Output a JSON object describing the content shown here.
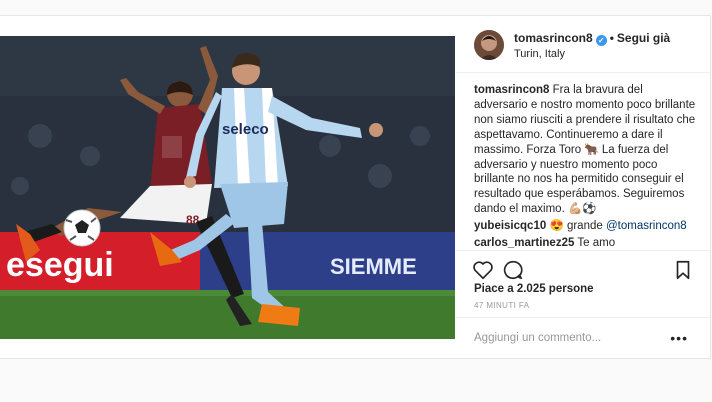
{
  "post": {
    "username": "tomasrincon8",
    "verified_mark": "✓",
    "separator": "•",
    "follow_label": "Segui già",
    "location": "Turin, Italy",
    "caption": "Fra la bravura del adversario e nostro momento poco brillante non siamo riusciti a prendere il risultato che aspettavamo. Continueremo a dare il massimo. Forza Toro 🐂 La fuerza del adversario y nuestro momento poco brillante no nos ha permitido conseguir el resultado que esperábamos. Seguiremos dando el maximo. 💪🏼⚽",
    "comments": [
      {
        "user": "yubeisicqc10",
        "text": "😍 grande ",
        "mention": "@tomasrincon8"
      },
      {
        "user": "carlos_martinez25",
        "text": "Te amo",
        "mention": ""
      }
    ],
    "likes": "Piace a 2.025 persone",
    "time": "47 MINUTI FA",
    "comment_placeholder": "Aggiungi un commento...",
    "more": "•••"
  },
  "photo": {
    "banner_left": "esegui",
    "banner_right": "SIEMME",
    "jersey_sponsor": "seleco",
    "jersey_number": "88"
  },
  "icons": [
    "heart-icon",
    "comment-icon",
    "bookmark-icon",
    "verified-icon",
    "more-icon"
  ],
  "colors": {
    "accent": "#3897f0",
    "text": "#262626",
    "muted": "#999999"
  }
}
